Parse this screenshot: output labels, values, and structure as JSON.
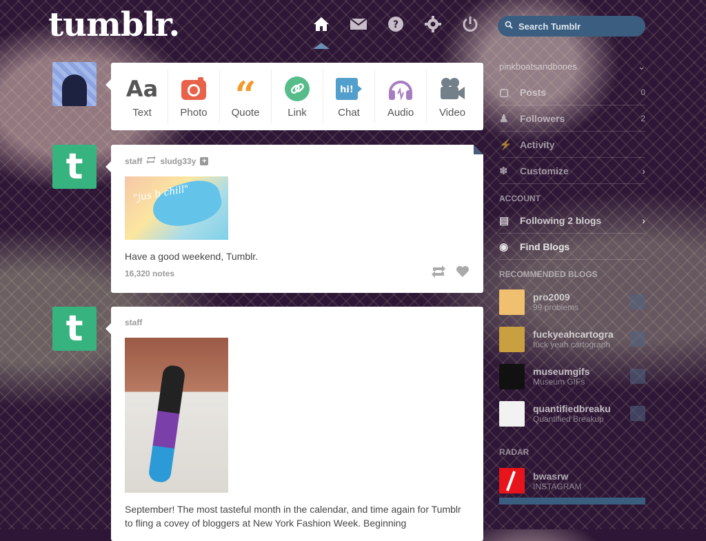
{
  "header": {
    "logo": "tumblr.",
    "nav": [
      {
        "name": "home-icon",
        "active": true
      },
      {
        "name": "mail-icon",
        "active": false
      },
      {
        "name": "help-icon",
        "active": false
      },
      {
        "name": "gear-icon",
        "active": false
      },
      {
        "name": "power-icon",
        "active": false
      }
    ],
    "search_placeholder": "Search Tumblr"
  },
  "composer": {
    "items": [
      {
        "label": "Text",
        "icon": "text-icon",
        "color": "#555555"
      },
      {
        "label": "Photo",
        "icon": "camera-icon",
        "color": "#e8624a"
      },
      {
        "label": "Quote",
        "icon": "quote-icon",
        "color": "#f2992e"
      },
      {
        "label": "Link",
        "icon": "link-icon",
        "color": "#56bc8a"
      },
      {
        "label": "Chat",
        "icon": "chat-icon",
        "color": "#529ecc"
      },
      {
        "label": "Audio",
        "icon": "headphones-icon",
        "color": "#a77dc2"
      },
      {
        "label": "Video",
        "icon": "video-camera-icon",
        "color": "#748089"
      }
    ]
  },
  "posts": [
    {
      "author": "staff",
      "reblogged_from": "sludg33y",
      "image_text": "\"jus b chill\"",
      "body": "Have a good weekend, Tumblr.",
      "notes": "16,320 notes"
    },
    {
      "author": "staff",
      "body": "September! The most tasteful month in the calendar, and time again for Tumblr to fling a covey of bloggers at New York Fashion Week. Beginning"
    }
  ],
  "sidebar": {
    "blog_name": "pinkboatsandbones",
    "rows": [
      {
        "icon": "posts-icon",
        "label": "Posts",
        "count": "0"
      },
      {
        "icon": "followers-icon",
        "label": "Followers",
        "count": "2"
      },
      {
        "icon": "activity-icon",
        "label": "Activity",
        "count": ""
      },
      {
        "icon": "customize-icon",
        "label": "Customize",
        "count": ""
      }
    ],
    "account_heading": "ACCOUNT",
    "account_rows": [
      {
        "icon": "following-icon",
        "label": "Following 2 blogs"
      },
      {
        "icon": "compass-icon",
        "label": "Find Blogs"
      }
    ],
    "recommended_heading": "RECOMMENDED BLOGS",
    "recommended": [
      {
        "name": "pro2009",
        "desc": "99 problems",
        "color": "#f0c070"
      },
      {
        "name": "fuckyeahcartogra",
        "desc": "fuck yeah cartograph",
        "color": "#c9a040"
      },
      {
        "name": "museumgifs",
        "desc": "Museum GIFs",
        "color": "#111111"
      },
      {
        "name": "quantifiedbreaku",
        "desc": "Quantified Breakup",
        "color": "#f2f2f2"
      }
    ],
    "radar_heading": "RADAR",
    "radar": {
      "name": "bwasrw",
      "desc": "INSTAGRAM"
    }
  }
}
